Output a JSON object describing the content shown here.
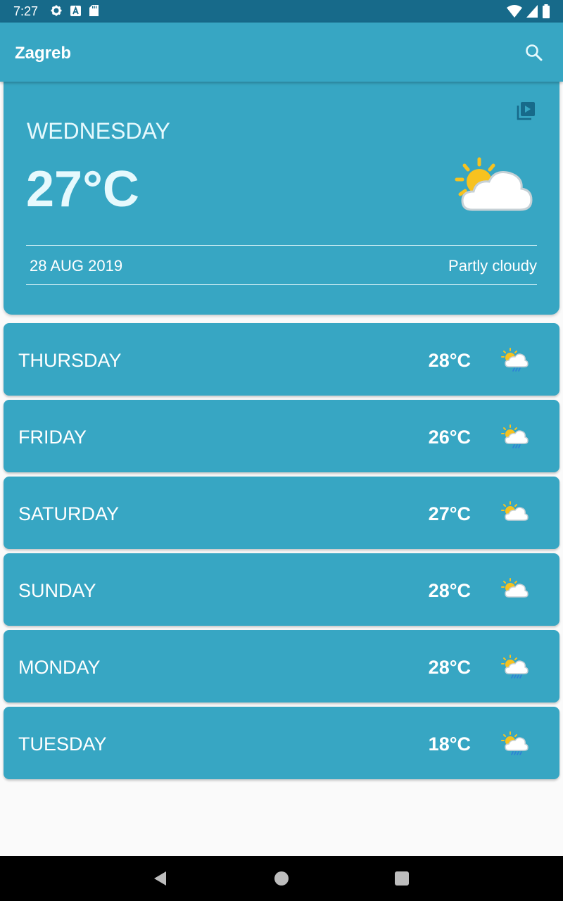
{
  "status_bar": {
    "time": "7:27"
  },
  "app_bar": {
    "title": "Zagreb"
  },
  "today": {
    "day": "WEDNESDAY",
    "temperature": "27°C",
    "date": "28 AUG 2019",
    "condition": "Partly cloudy"
  },
  "forecast": [
    {
      "day": "THURSDAY",
      "temperature": "28°C",
      "icon": "partly-cloudy-rain-icon"
    },
    {
      "day": "FRIDAY",
      "temperature": "26°C",
      "icon": "partly-cloudy-rain-icon"
    },
    {
      "day": "SATURDAY",
      "temperature": "27°C",
      "icon": "partly-cloudy-icon"
    },
    {
      "day": "SUNDAY",
      "temperature": "28°C",
      "icon": "partly-cloudy-icon"
    },
    {
      "day": "MONDAY",
      "temperature": "28°C",
      "icon": "partly-cloudy-rain-icon"
    },
    {
      "day": "TUESDAY",
      "temperature": "18°C",
      "icon": "partly-cloudy-rain-icon"
    }
  ],
  "colors": {
    "status_bar": "#176a8a",
    "primary": "#37a6c3",
    "background": "#fafafa",
    "text_light": "#e6f9fd"
  }
}
